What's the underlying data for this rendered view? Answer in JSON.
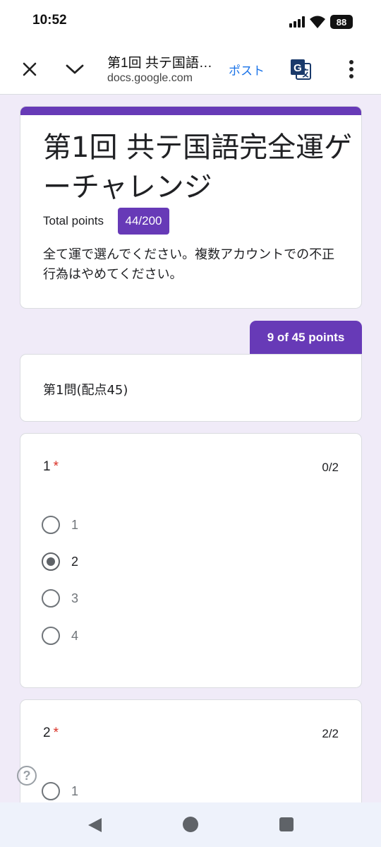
{
  "status_bar": {
    "time": "10:52",
    "battery": "88",
    "icons": [
      "signal-icon",
      "wifi-icon",
      "battery-icon"
    ]
  },
  "toolbar": {
    "title": "第1回 共テ国語…",
    "url": "docs.google.com",
    "post_label": "ポスト",
    "icons": [
      "close-icon",
      "chevron-down-icon",
      "translate-icon",
      "more-vert-icon"
    ]
  },
  "form": {
    "accent_color": "#673ab7",
    "title": "第1回 共テ国語完全運ゲーチャレンジ",
    "total_label": "Total points",
    "total_score": "44/200",
    "description": "全て運で選んでください。複数アカウントでの不正行為はやめてください。"
  },
  "section": {
    "points_tab": "9 of 45 points",
    "title": "第1問(配点45)"
  },
  "questions": [
    {
      "number": "1",
      "required_mark": "*",
      "score": "0/2",
      "options": [
        "1",
        "2",
        "3",
        "4"
      ],
      "selected": "2"
    },
    {
      "number": "2",
      "required_mark": "*",
      "score": "2/2",
      "options": [
        "1"
      ]
    }
  ],
  "help": {
    "label": "?"
  },
  "nav_bar": {
    "icons": [
      "back-icon",
      "home-icon",
      "recents-icon"
    ]
  }
}
